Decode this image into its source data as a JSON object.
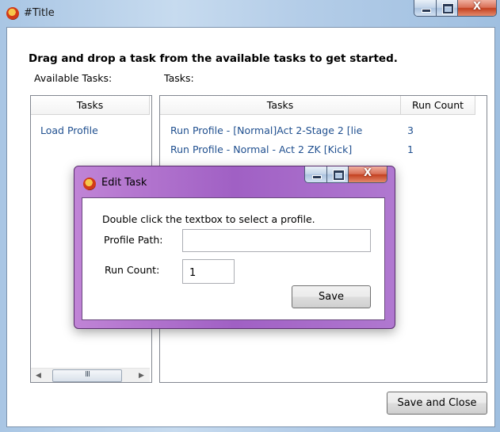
{
  "main_window": {
    "title": "#Title",
    "instruction": "Drag and drop a task from the available tasks to get started.",
    "available_tasks_label": "Available Tasks:",
    "tasks_label": "Tasks:",
    "available_list": {
      "header": "Tasks",
      "items": [
        "Load Profile"
      ]
    },
    "tasks_table": {
      "columns": [
        "Tasks",
        "Run Count"
      ],
      "rows": [
        {
          "task": "Run Profile - [Normal]Act 2-Stage 2 [lie",
          "run_count": "3"
        },
        {
          "task": "Run Profile - Normal - Act 2 ZK [Kick]",
          "run_count": "1"
        }
      ]
    },
    "save_and_close_label": "Save and Close",
    "scroll_thumb_grip": "III"
  },
  "edit_task_dialog": {
    "title": "Edit Task",
    "hint": "Double click the textbox to select a profile.",
    "profile_path_label": "Profile Path:",
    "profile_path_value": "",
    "run_count_label": "Run Count:",
    "run_count_value": "1",
    "save_label": "Save"
  },
  "icons": {
    "app": "devil-face-icon",
    "minimize": "minimize-icon",
    "maximize": "maximize-icon",
    "close": "close-icon",
    "scroll_left": "arrow-left-icon",
    "scroll_right": "arrow-right-icon"
  },
  "colors": {
    "link_text": "#1f4f8f",
    "close_button": "#c3401f",
    "main_frame": "#b4cde8",
    "dialog_frame": "#a060c4"
  }
}
